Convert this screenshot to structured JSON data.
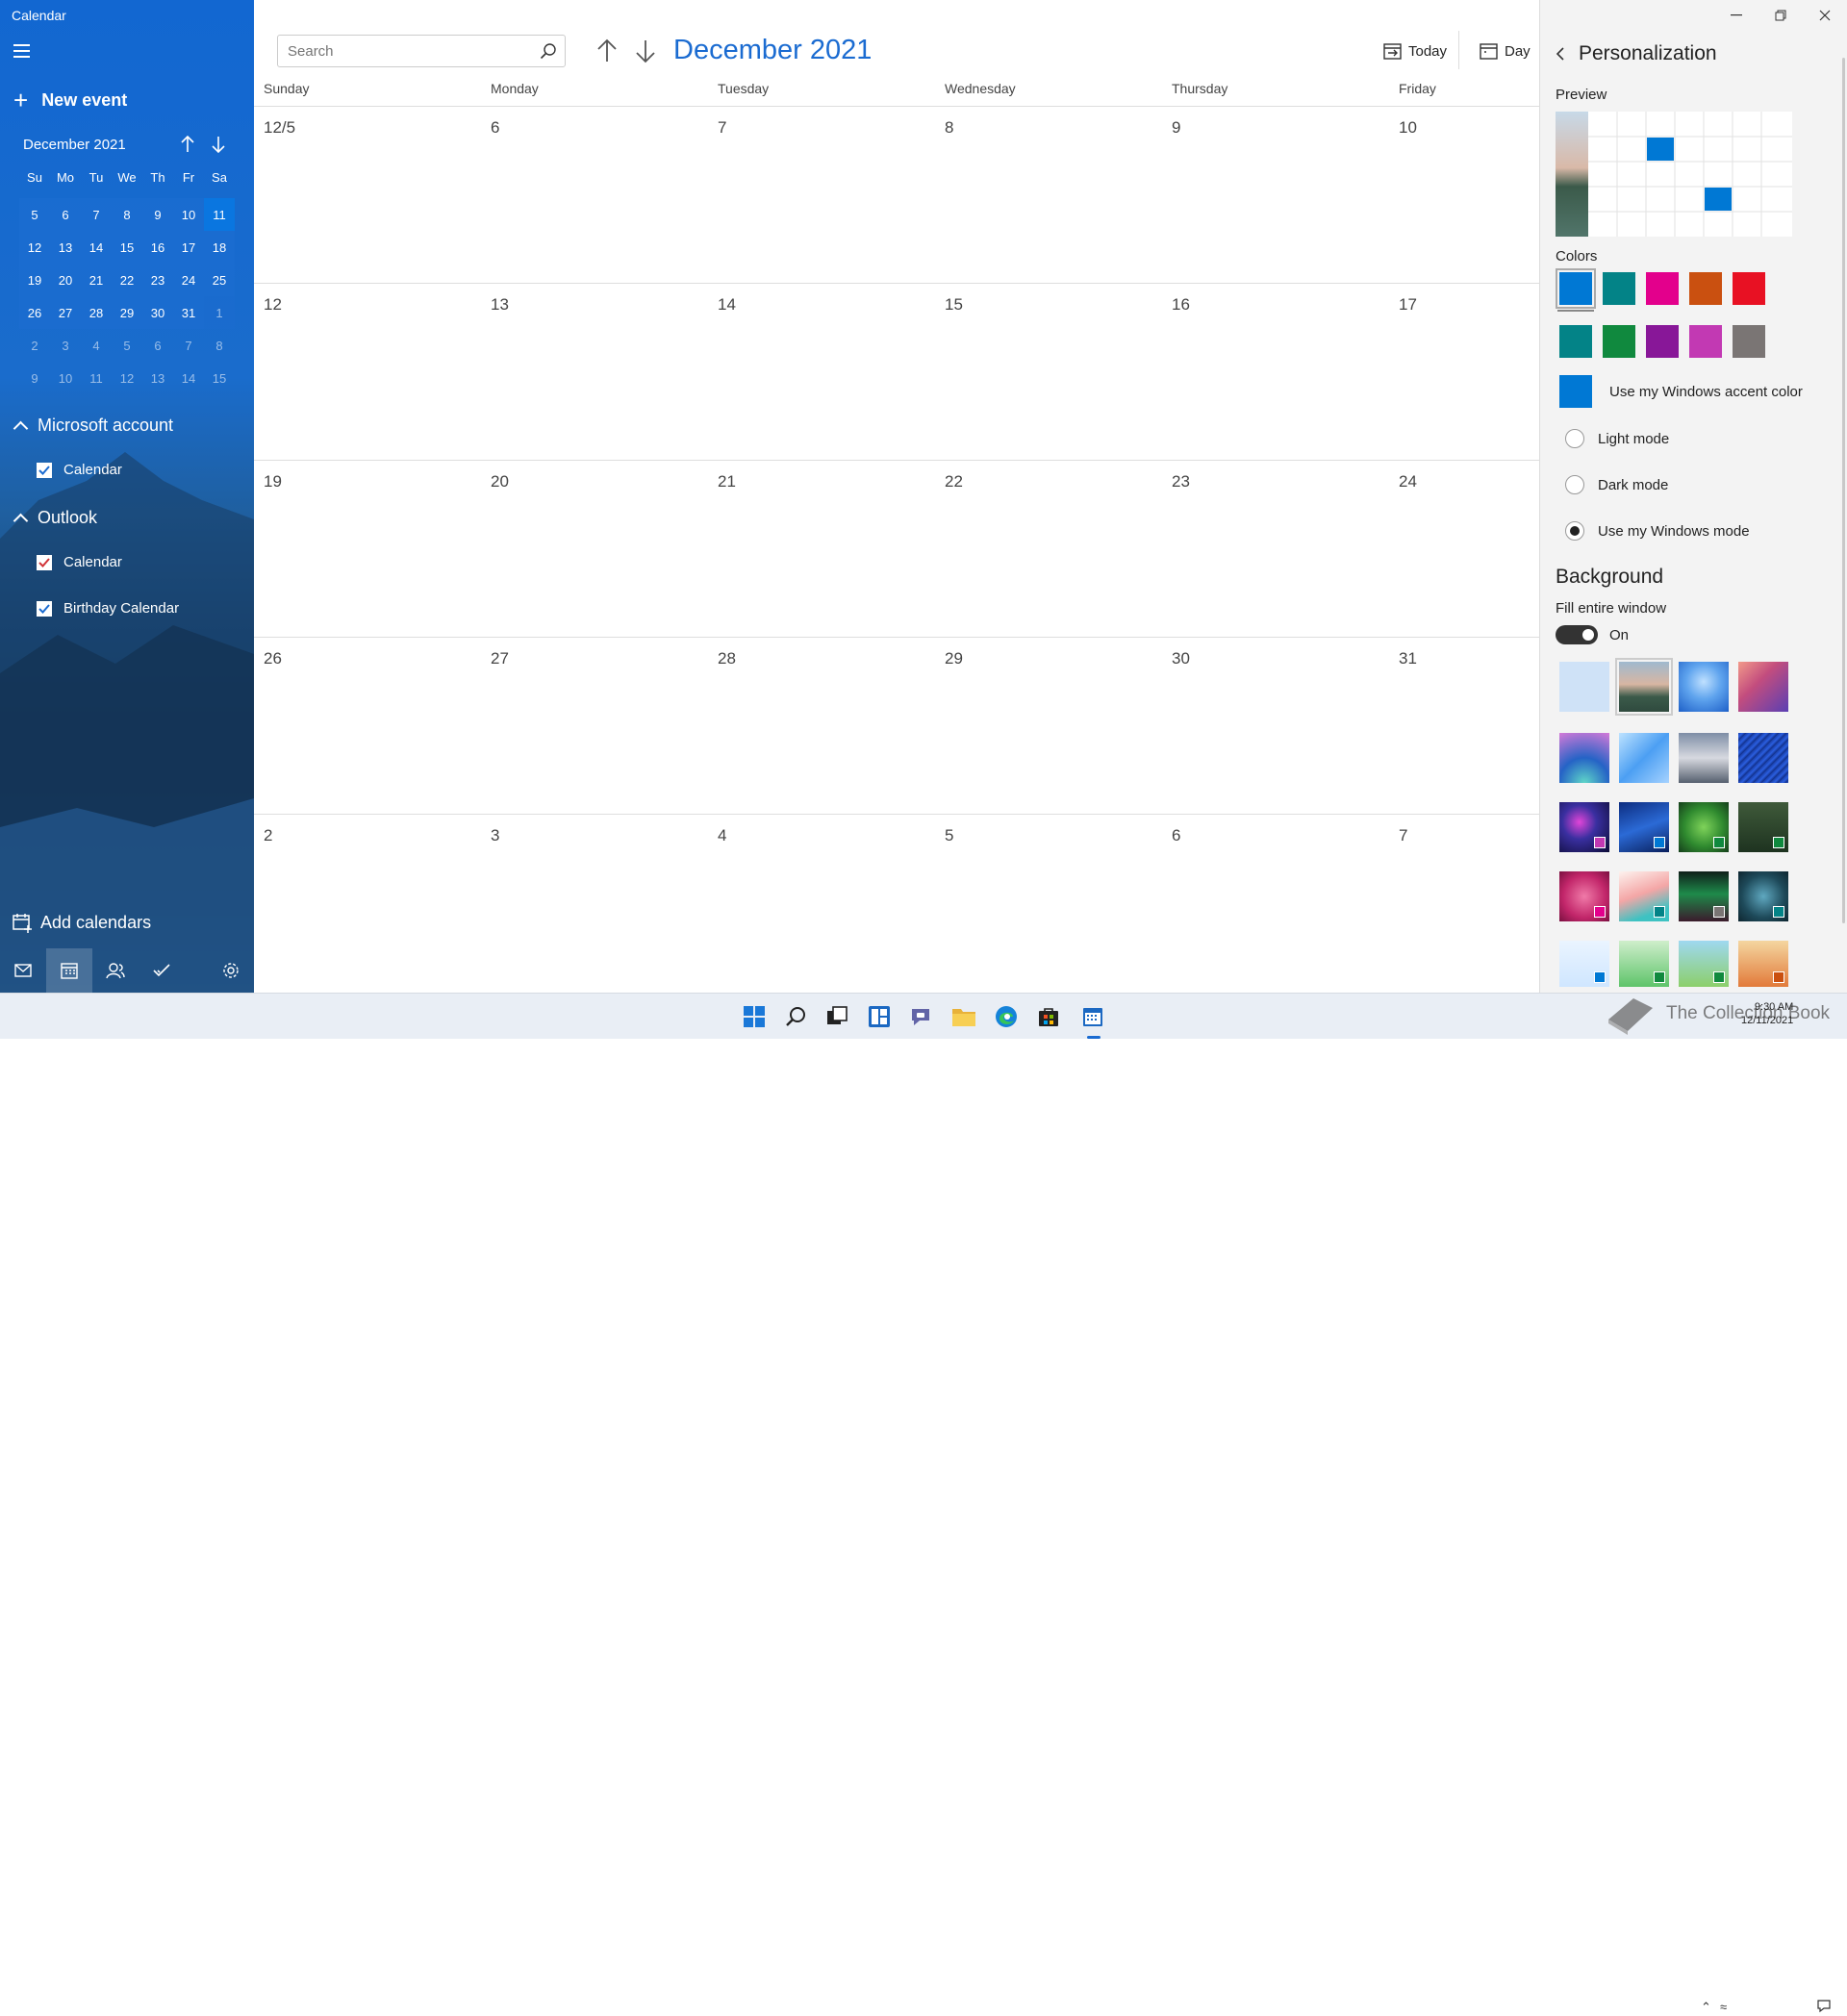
{
  "window": {
    "title": "Calendar"
  },
  "sidebar": {
    "new_event": "New event",
    "mini_calendar": {
      "month_label": "December 2021",
      "weekdays": [
        "Su",
        "Mo",
        "Tu",
        "We",
        "Th",
        "Fr",
        "Sa"
      ],
      "weeks": [
        [
          "5",
          "6",
          "7",
          "8",
          "9",
          "10",
          "11"
        ],
        [
          "12",
          "13",
          "14",
          "15",
          "16",
          "17",
          "18"
        ],
        [
          "19",
          "20",
          "21",
          "22",
          "23",
          "24",
          "25"
        ],
        [
          "26",
          "27",
          "28",
          "29",
          "30",
          "31",
          "1"
        ],
        [
          "2",
          "3",
          "4",
          "5",
          "6",
          "7",
          "8"
        ],
        [
          "9",
          "10",
          "11",
          "12",
          "13",
          "14",
          "15"
        ]
      ],
      "today": "11"
    },
    "accounts": [
      {
        "name": "Microsoft account",
        "calendars": [
          {
            "label": "Calendar",
            "color": "#1a6bd1"
          }
        ]
      },
      {
        "name": "Outlook",
        "calendars": [
          {
            "label": "Calendar",
            "color": "#d13438"
          },
          {
            "label": "Birthday Calendar",
            "color": "#1a6bd1"
          }
        ]
      }
    ],
    "add_calendars": "Add calendars",
    "bottom_nav": [
      "mail-icon",
      "calendar-icon",
      "people-icon",
      "todo-icon",
      "settings-icon"
    ]
  },
  "toolbar": {
    "search_placeholder": "Search",
    "month_title": "December 2021",
    "today_label": "Today",
    "day_label": "Day"
  },
  "calendar": {
    "weekdays": [
      "Sunday",
      "Monday",
      "Tuesday",
      "Wednesday",
      "Thursday",
      "Friday"
    ],
    "weeks": [
      [
        "12/5",
        "6",
        "7",
        "8",
        "9",
        "10"
      ],
      [
        "12",
        "13",
        "14",
        "15",
        "16",
        "17"
      ],
      [
        "19",
        "20",
        "21",
        "22",
        "23",
        "24"
      ],
      [
        "26",
        "27",
        "28",
        "29",
        "30",
        "31"
      ],
      [
        "2",
        "3",
        "4",
        "5",
        "6",
        "7"
      ]
    ]
  },
  "personalization": {
    "title": "Personalization",
    "preview_label": "Preview",
    "colors_label": "Colors",
    "colors": [
      "#0078d4",
      "#038387",
      "#e3008c",
      "#ca5010",
      "#e81123",
      "#038387",
      "#10893e",
      "#881798",
      "#c239b3",
      "#7a7574"
    ],
    "selected_color": "#0078d4",
    "accent_label": "Use my Windows accent color",
    "accent_color": "#0078d4",
    "modes": [
      {
        "label": "Light mode",
        "checked": false
      },
      {
        "label": "Dark mode",
        "checked": false
      },
      {
        "label": "Use my Windows mode",
        "checked": true
      }
    ],
    "background_title": "Background",
    "fill_label": "Fill entire window",
    "toggle_label": "On"
  },
  "taskbar": {
    "watermark": "The Collection Book",
    "time": "9:30 AM",
    "date": "12/11/2021"
  }
}
